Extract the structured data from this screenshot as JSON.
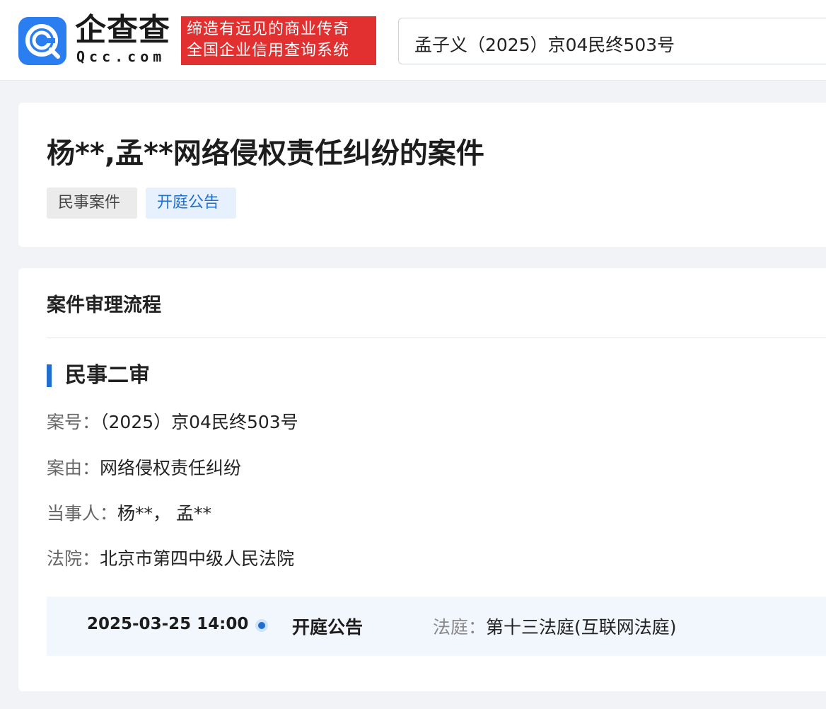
{
  "header": {
    "logo_main": "企查查",
    "logo_sub": "Qcc.com",
    "slogan_line1": "缔造有远见的商业传奇",
    "slogan_line2": "全国企业信用查询系统",
    "search_value": "孟子义（2025）京04民终503号"
  },
  "case": {
    "title": "杨**,孟**网络侵权责任纠纷的案件",
    "tags": [
      "民事案件",
      "开庭公告"
    ]
  },
  "flow": {
    "heading": "案件审理流程",
    "stage": "民事二审",
    "fields": [
      {
        "label": "案号：",
        "value": "（2025）京04民终503号"
      },
      {
        "label": "案由：",
        "value": "网络侵权责任纠纷"
      },
      {
        "label": "当事人：",
        "value": "杨**， 孟**"
      },
      {
        "label": "法院：",
        "value": "北京市第四中级人民法院"
      }
    ],
    "timeline": {
      "datetime": "2025-03-25 14:00",
      "event": "开庭公告",
      "court_label": "法庭：",
      "court_value": "第十三法庭(互联网法庭)"
    }
  },
  "colors": {
    "brand_blue": "#1f6fd1",
    "slogan_red": "#e22f2f",
    "logo_blue": "#2a7ef0"
  }
}
